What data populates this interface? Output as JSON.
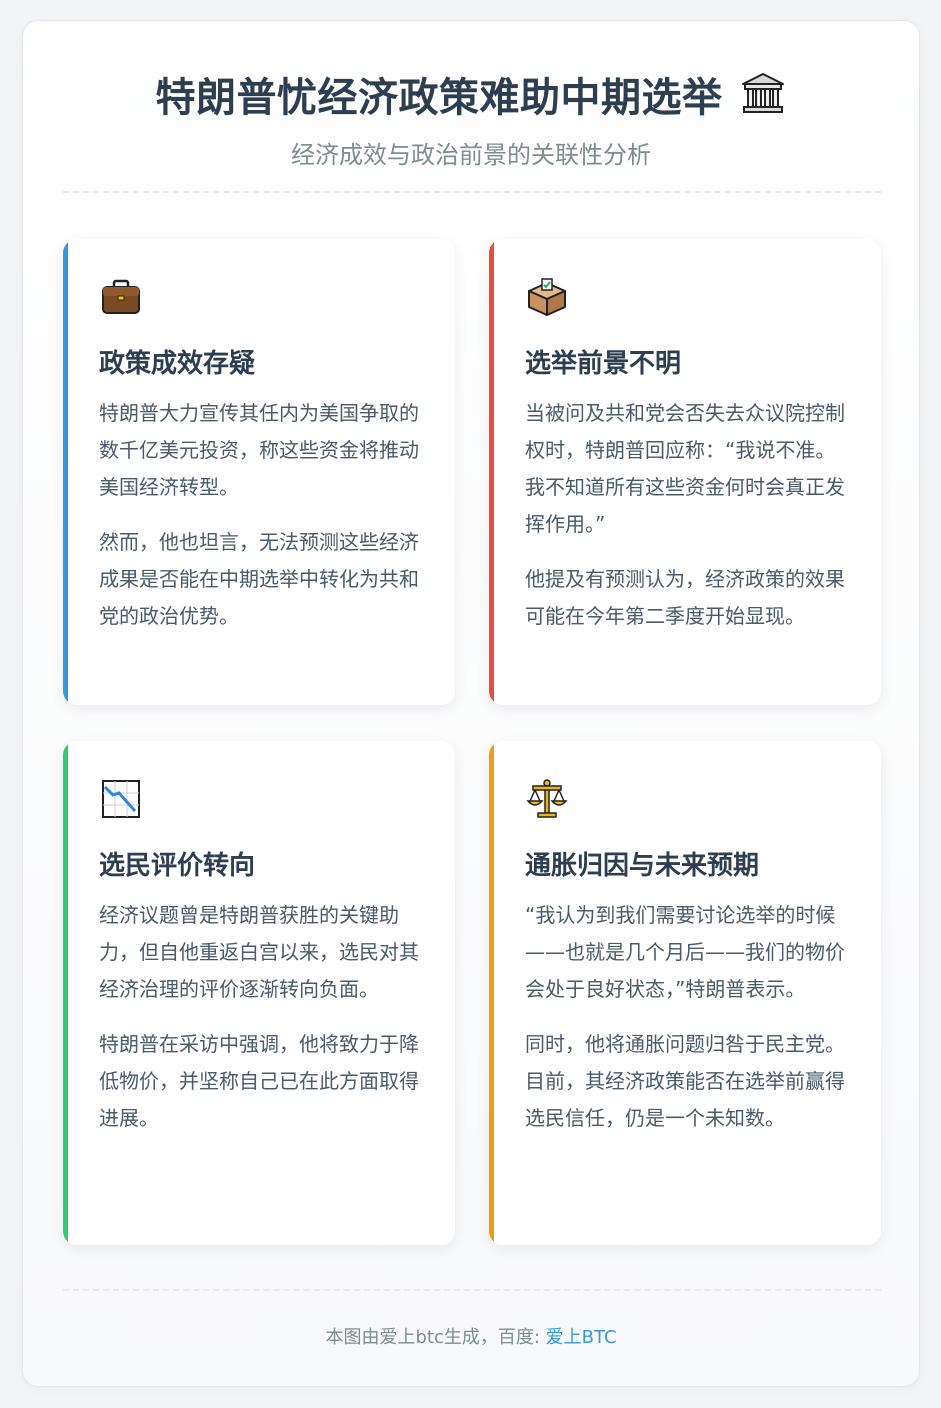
{
  "header": {
    "title": "特朗普忧经济政策难助中期选举",
    "title_icon": "classical-building-icon",
    "subtitle": "经济成效与政治前景的关联性分析"
  },
  "cards": [
    {
      "icon": "briefcase-icon",
      "accent": "#3498db",
      "title": "政策成效存疑",
      "paragraphs": [
        "特朗普大力宣传其任内为美国争取的数千亿美元投资，称这些资金将推动美国经济转型。",
        "然而，他也坦言，无法预测这些经济成果是否能在中期选举中转化为共和党的政治优势。"
      ]
    },
    {
      "icon": "ballot-box-icon",
      "accent": "#e74c3c",
      "title": "选举前景不明",
      "paragraphs": [
        "当被问及共和党会否失去众议院控制权时，特朗普回应称：“我说不准。我不知道所有这些资金何时会真正发挥作用。”",
        "他提及有预测认为，经济政策的效果可能在今年第二季度开始显现。"
      ]
    },
    {
      "icon": "chart-decreasing-icon",
      "accent": "#2ecc71",
      "title": "选民评价转向",
      "paragraphs": [
        "经济议题曾是特朗普获胜的关键助力，但自他重返白宫以来，选民对其经济治理的评价逐渐转向负面。",
        "特朗普在采访中强调，他将致力于降低物价，并坚称自己已在此方面取得进展。"
      ]
    },
    {
      "icon": "balance-scale-icon",
      "accent": "#f39c12",
      "title": "通胀归因与未来预期",
      "paragraphs": [
        "“我认为到我们需要讨论选举的时候——也就是几个月后——我们的物价会处于良好状态，”特朗普表示。",
        "同时，他将通胀问题归咎于民主党。目前，其经济政策能否在选举前赢得选民信任，仍是一个未知数。"
      ]
    }
  ],
  "footer": {
    "text": "本图由爱上btc生成，百度: ",
    "link_label": "爱上BTC"
  }
}
